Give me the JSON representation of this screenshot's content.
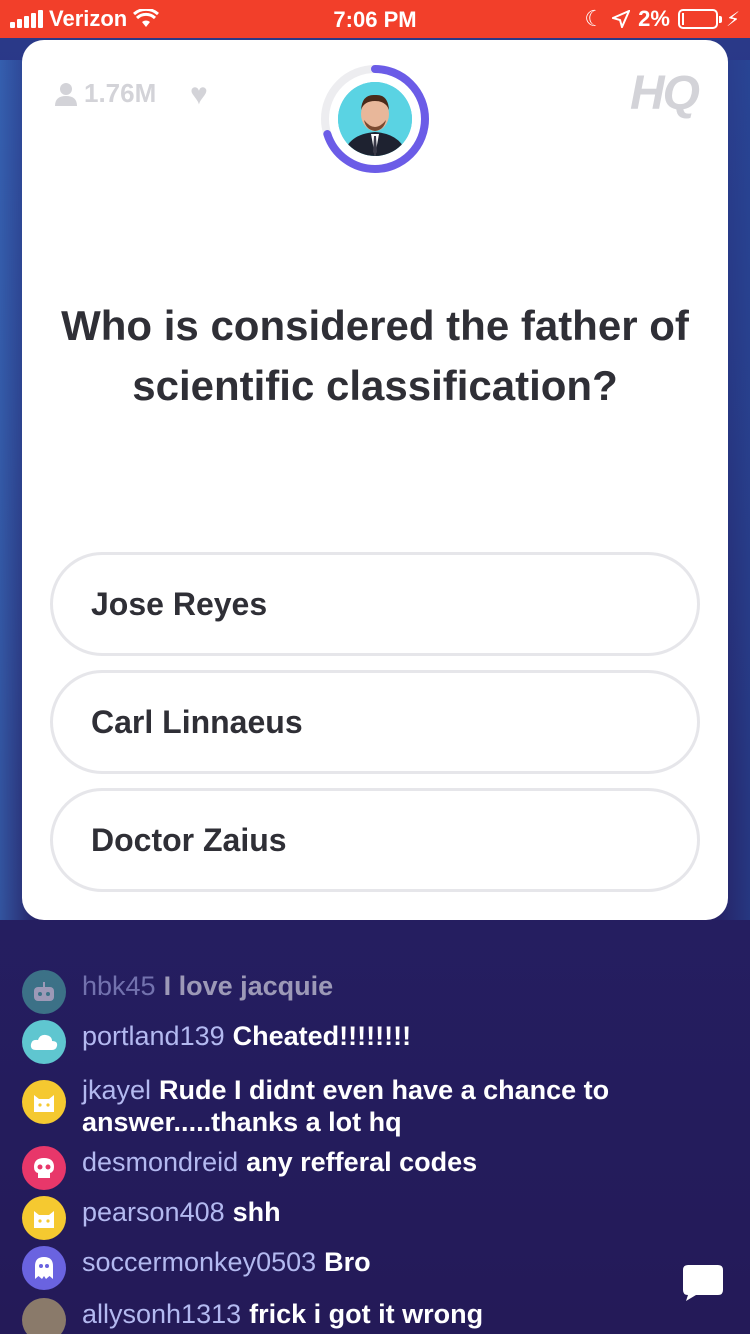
{
  "status_bar": {
    "carrier": "Verizon",
    "time": "7:06 PM",
    "battery": "2%"
  },
  "game": {
    "viewer_count": "1.76M",
    "logo": "HQ",
    "question": "Who is considered the father of scientific classification?",
    "options": [
      {
        "label": "Jose Reyes"
      },
      {
        "label": "Carl Linnaeus"
      },
      {
        "label": "Doctor Zaius"
      }
    ],
    "timer_fraction": 0.7,
    "accent_color": "#6b5ce7"
  },
  "chat": [
    {
      "user": "hbk45",
      "message": "I love jacquie",
      "avatar_color": "#4fb7a8",
      "avatar_icon": "robot-icon"
    },
    {
      "user": "portland139",
      "message": "Cheated!!!!!!!!",
      "avatar_color": "#5fc6d0",
      "avatar_icon": "cloud-icon"
    },
    {
      "user": "jkayel",
      "message": "Rude I didnt even have a chance to answer.....thanks a lot hq",
      "avatar_color": "#f5c930",
      "avatar_icon": "cat-icon"
    },
    {
      "user": "desmondreid",
      "message": "any refferal codes",
      "avatar_color": "#e8376a",
      "avatar_icon": "skull-icon"
    },
    {
      "user": "pearson408",
      "message": "shh",
      "avatar_color": "#f5c930",
      "avatar_icon": "cat-icon"
    },
    {
      "user": "soccermonkey0503",
      "message": "Bro",
      "avatar_color": "#6a63e0",
      "avatar_icon": "ghost-icon"
    },
    {
      "user": "allysonh1313",
      "message": "frick i got it wrong",
      "avatar_color": "#8a7a6a",
      "avatar_icon": "photo-avatar"
    }
  ]
}
